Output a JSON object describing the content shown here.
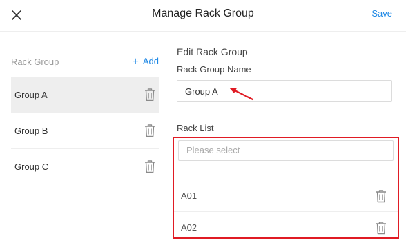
{
  "header": {
    "title": "Manage Rack Group",
    "save_label": "Save",
    "close_icon": "close-icon"
  },
  "sidebar": {
    "title": "Rack Group",
    "add_label": "Add",
    "add_icon": "+",
    "groups": [
      {
        "label": "Group A",
        "active": true
      },
      {
        "label": "Group B",
        "active": false
      },
      {
        "label": "Group C",
        "active": false
      }
    ]
  },
  "edit": {
    "section_title": "Edit Rack Group",
    "name_label": "Rack Group Name",
    "name_value": "Group A",
    "rack_list_label": "Rack List",
    "rack_placeholder": "Please select",
    "racks": [
      {
        "label": "A01"
      },
      {
        "label": "A02"
      }
    ]
  },
  "colors": {
    "accent": "#1e88e5",
    "annotation": "#e01b24",
    "active_row": "#eeeeee"
  }
}
